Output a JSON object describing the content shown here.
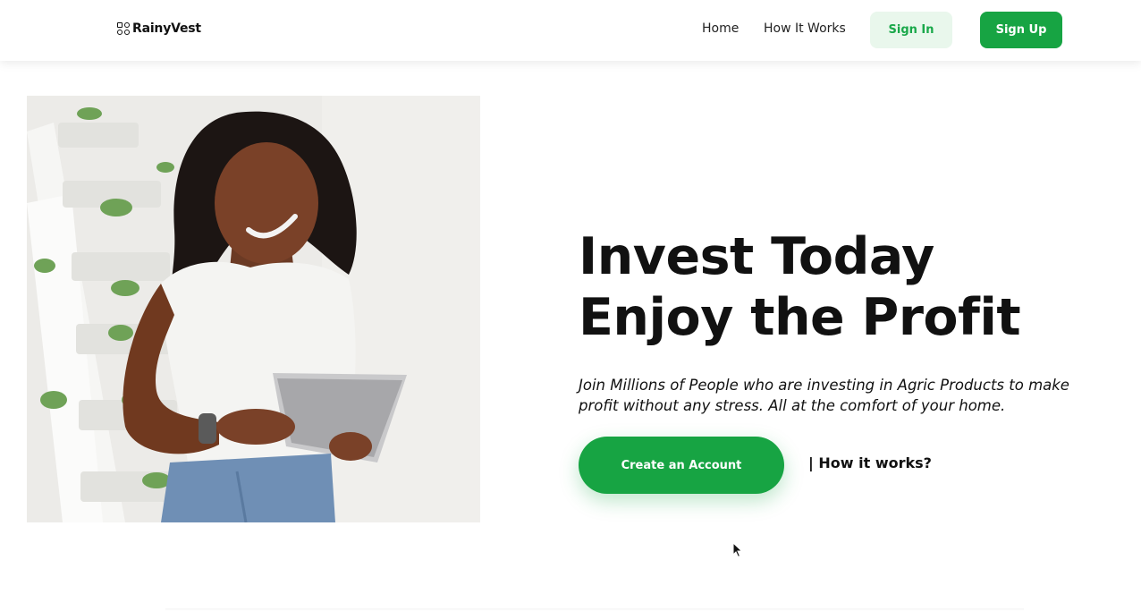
{
  "header": {
    "logo_text": "RainyVest",
    "nav": {
      "home": "Home",
      "how_it_works": "How It Works"
    },
    "sign_in": "Sign In",
    "sign_up": "Sign Up"
  },
  "hero": {
    "title_line1": "Invest Today",
    "title_line2": "Enjoy the Profit",
    "subtitle": "Join Millions of People who are investing in Agric Products to make profit without any stress. All at the comfort of your home.",
    "cta_label": "Create an Account",
    "secondary_link": "| How it works?"
  },
  "colors": {
    "brand_green": "#17a443",
    "light_green": "#e9f7ec",
    "text": "#111111"
  },
  "icons": {
    "logo": "grid-logo-icon",
    "cursor": "mouse-pointer-icon"
  }
}
